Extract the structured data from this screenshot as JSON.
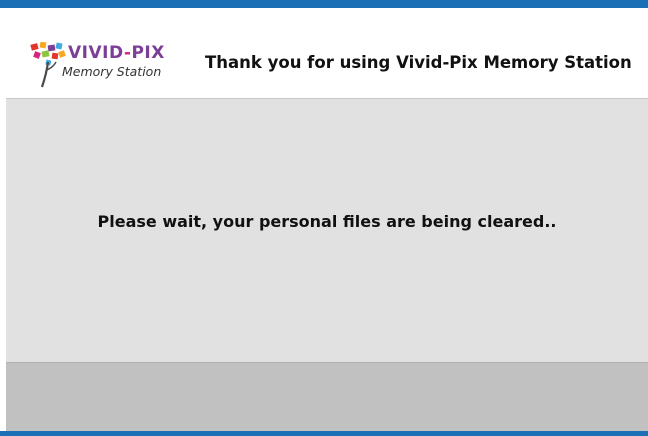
{
  "logo": {
    "word_part1": "VIVID",
    "word_dash": "-",
    "word_part2": "PIX",
    "subtitle": "Memory Station",
    "icon": "tree-logo-icon"
  },
  "header": {
    "title": "Thank you for using Vivid-Pix Memory Station"
  },
  "main": {
    "message": "Please wait, your personal files are being cleared.."
  },
  "colors": {
    "accent_bar": "#1a6fb5",
    "main_background": "#e1e1e1",
    "footer_background": "#c1c1c1"
  }
}
